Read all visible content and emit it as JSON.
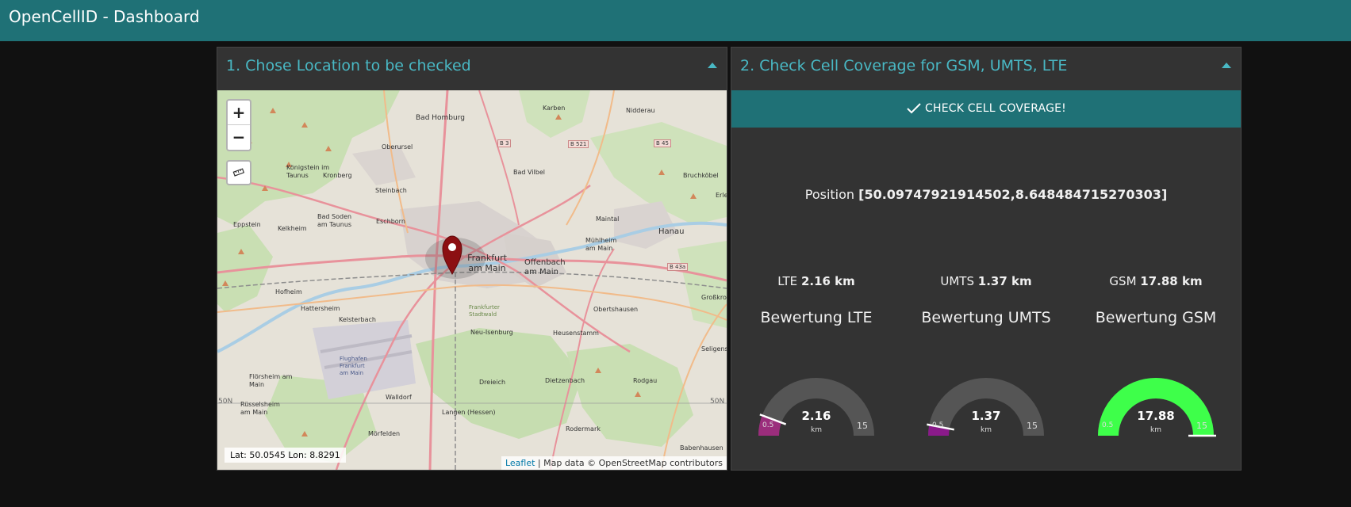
{
  "app": {
    "title": "OpenCellID - Dashboard"
  },
  "panel_location": {
    "title": "1. Chose Location to be checked",
    "latlon": "Lat: 50.0545  Lon: 8.8291",
    "zoom_in": "+",
    "zoom_out": "−",
    "attribution_link": "Leaflet",
    "attribution_text": " | Map data © OpenStreetMap contributors",
    "places": [
      "Bad Homburg",
      "Karben",
      "Nidderau",
      "Oberursel",
      "Bad Vilbel",
      "Bruchköbel",
      "Königstein im Taunus",
      "Kronberg",
      "Steinbach",
      "Eschborn",
      "Bad Soden am Taunus",
      "Eppstein",
      "Kelkheim",
      "Frankfurt am Main",
      "Offenbach am Main",
      "Maintal",
      "Hanau",
      "Mühlheim am Main",
      "Hofheim",
      "Hattersheim",
      "Kelsterbach",
      "Neu-Isenburg",
      "Heusenstamm",
      "Obertshausen",
      "Großkrotzenburg",
      "Seligenstadt",
      "Flörsheim am Main",
      "Rüsselsheim am Main",
      "Walldorf",
      "Dreieich",
      "Dietzenbach",
      "Rodgau",
      "Langen (Hessen)",
      "Mörfelden",
      "Rodermark",
      "Babenhausen",
      "Erlensee",
      "Flughafen Frankfurt am Main",
      "Frankfurter Stadtwald"
    ],
    "road_labels": [
      "B 3",
      "B 521",
      "B 45",
      "B 43a"
    ],
    "grid_labels": [
      "50N",
      "50N"
    ]
  },
  "panel_coverage": {
    "title": "2. Check Cell Coverage for GSM, UMTS, LTE",
    "check_button": "CHECK CELL COVERAGE!",
    "position_label": "Position",
    "position_value": "[50.09747921914502,8.648484715270303]",
    "metrics": [
      {
        "name": "LTE",
        "value": "2.16 km",
        "rating_title": "Bewertung LTE",
        "gauge_value": 2.16,
        "gauge_text": "2.16",
        "color": "#9b2d7c"
      },
      {
        "name": "UMTS",
        "value": "1.37 km",
        "rating_title": "Bewertung UMTS",
        "gauge_value": 1.37,
        "gauge_text": "1.37",
        "color": "#8a1a8a"
      },
      {
        "name": "GSM",
        "value": "17.88 km",
        "rating_title": "Bewertung GSM",
        "gauge_value": 17.88,
        "gauge_text": "17.88",
        "color": "#3eff4a"
      }
    ],
    "gauge_min": "0.5",
    "gauge_max": "15",
    "gauge_unit": "km",
    "gauge_track_color": "#555555"
  }
}
